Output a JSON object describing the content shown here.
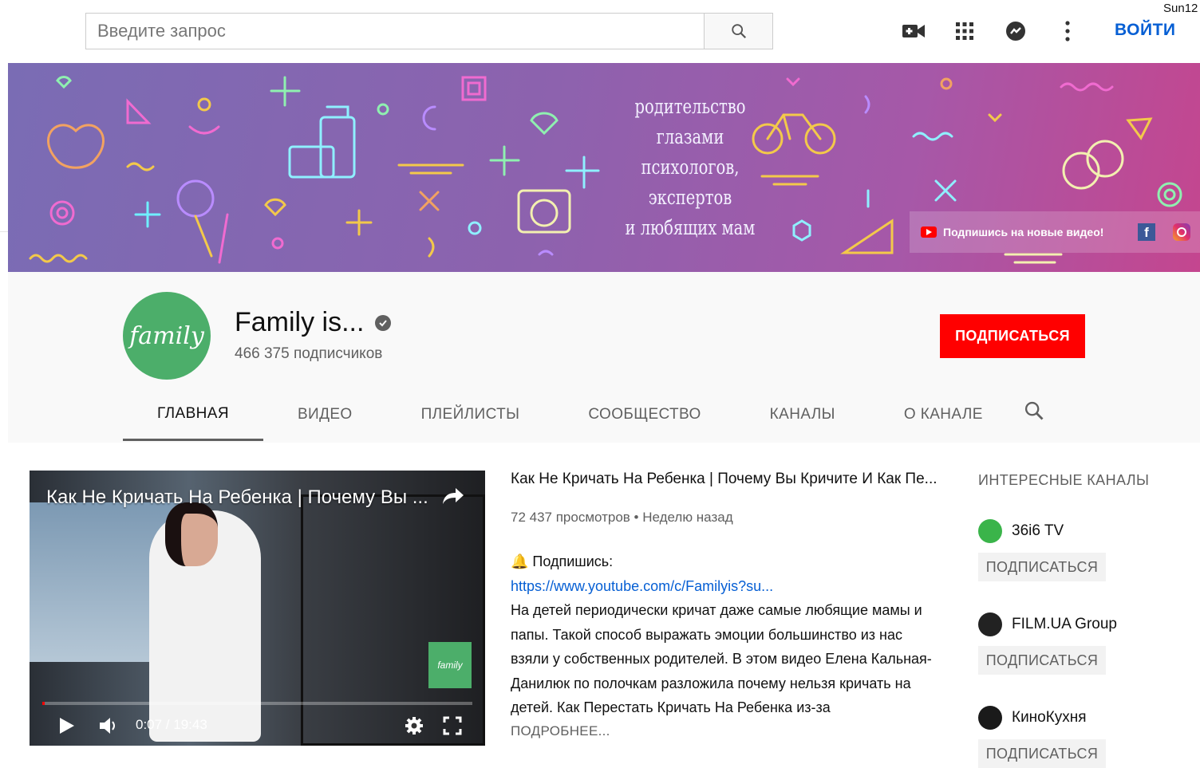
{
  "topbar": {
    "search_placeholder": "Введите запрос",
    "login_label": "ВОЙТИ",
    "username": "Sun12",
    "icons": [
      "video-camera-icon",
      "apps-grid-icon",
      "messages-icon",
      "more-vert-icon"
    ]
  },
  "banner": {
    "tagline_lines": [
      "родительство",
      "глазами",
      "психологов,",
      "экспертов",
      "и любящих мам"
    ],
    "subscribe_prompt": "Подпишись на новые видео!",
    "facebook_glyph": "f"
  },
  "channel": {
    "name": "Family is...",
    "subscribers": "466 375 подписчиков",
    "subscribe_label": "ПОДПИСАТЬСЯ",
    "avatar_text": "family"
  },
  "tabs": [
    {
      "label": "ГЛАВНАЯ",
      "active": true
    },
    {
      "label": "ВИДЕО"
    },
    {
      "label": "ПЛЕЙЛИСТЫ"
    },
    {
      "label": "СООБЩЕСТВО"
    },
    {
      "label": "КАНАЛЫ"
    },
    {
      "label": "О КАНАЛЕ"
    }
  ],
  "player": {
    "title": "Как Не Кричать На Ребенка | Почему Вы ...",
    "time": "0:07 / 19:43",
    "progress_fraction": 0.006,
    "watermark_text": "family"
  },
  "featured": {
    "title": "Как Не Кричать На Ребенка | Почему Вы Кричите И Как Пе...",
    "meta": "72 437 просмотров • Неделю назад",
    "subscribe_line": "🔔 Подпишись:",
    "link": "https://www.youtube.com/c/Familyis?su...",
    "description": "На детей периодически кричат даже самые любящие мамы и папы. Такой способ выражать эмоции большинство из нас взяли у собственных родителей. В этом видео Елена Кальная-Данилюк по полочкам разложила почему нельзя кричать на детей. Как Перестать Кричать На Ребенка из-за",
    "more_label": "ПОДРОБНЕЕ..."
  },
  "sidebar": {
    "heading": "ИНТЕРЕСНЫЕ КАНАЛЫ",
    "channels": [
      {
        "name": "36i6 TV",
        "subscribe_label": "ПОДПИСАТЬСЯ",
        "color": "#3ab44a"
      },
      {
        "name": "FILM.UA Group",
        "subscribe_label": "ПОДПИСАТЬСЯ",
        "color": "#222222"
      },
      {
        "name": "КиноКухня",
        "subscribe_label": "ПОДПИСАТЬСЯ",
        "color": "#1a1a1a"
      }
    ]
  },
  "colors": {
    "accent_red": "#ff0000",
    "link_blue": "#065fd4",
    "banner_start": "#7a6cb4",
    "banner_end": "#c4468f"
  }
}
